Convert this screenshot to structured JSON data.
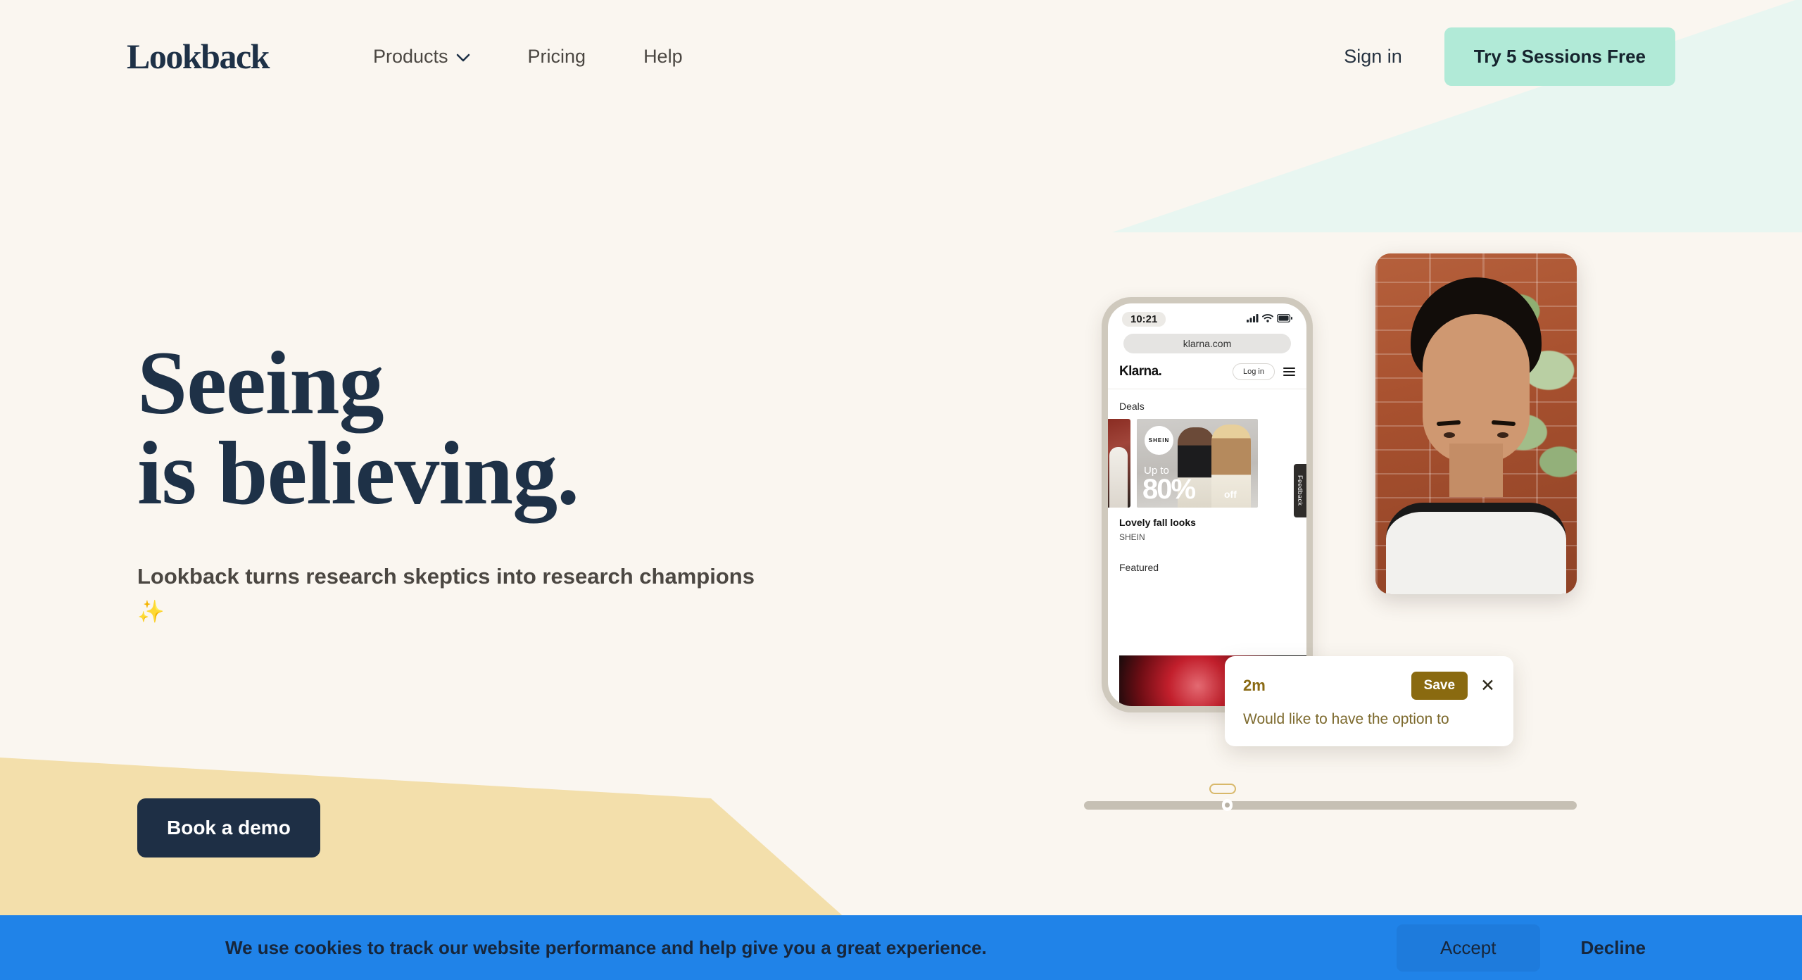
{
  "brand": {
    "name": "Lookback"
  },
  "nav": {
    "links": [
      {
        "label": "Products",
        "has_chevron": true,
        "icon": "chevron-down-icon"
      },
      {
        "label": "Pricing",
        "has_chevron": false
      },
      {
        "label": "Help",
        "has_chevron": false
      }
    ],
    "signin_label": "Sign in",
    "cta_label": "Try 5 Sessions Free"
  },
  "hero": {
    "headline_line1": "Seeing",
    "headline_line2": "is believing.",
    "subheadline": "Lookback turns research skeptics into research champions ✨",
    "demo_button": "Book a demo"
  },
  "visual": {
    "phone": {
      "status": {
        "time": "10:21",
        "signal_icon": "signal-bars-icon",
        "wifi_icon": "wifi-icon",
        "battery_icon": "battery-icon"
      },
      "url": "klarna.com",
      "site_logo": "Klarna.",
      "login_label": "Log in",
      "menu_icon": "hamburger-menu-icon",
      "section_deals": "Deals",
      "deal": {
        "badge": "SHEIN",
        "promo_prefix": "Up to",
        "promo_value": "80%",
        "promo_suffix": "off",
        "title": "Lovely fall looks",
        "brand": "SHEIN"
      },
      "feedback_tab": "Feedback",
      "section_featured": "Featured"
    },
    "note": {
      "timestamp": "2m",
      "save_label": "Save",
      "close_icon": "close-icon",
      "body": "Would like to have the option to"
    }
  },
  "cookie_banner": {
    "message": "We use cookies to track our website performance and help give you a great experience.",
    "accept_label": "Accept",
    "decline_label": "Decline"
  },
  "colors": {
    "page_bg": "#faf6f0",
    "navy": "#1e3147",
    "mint": "#b1ead7",
    "tan": "#f3dfab",
    "banner_blue": "#2083e8",
    "note_gold": "#8a6a10"
  }
}
